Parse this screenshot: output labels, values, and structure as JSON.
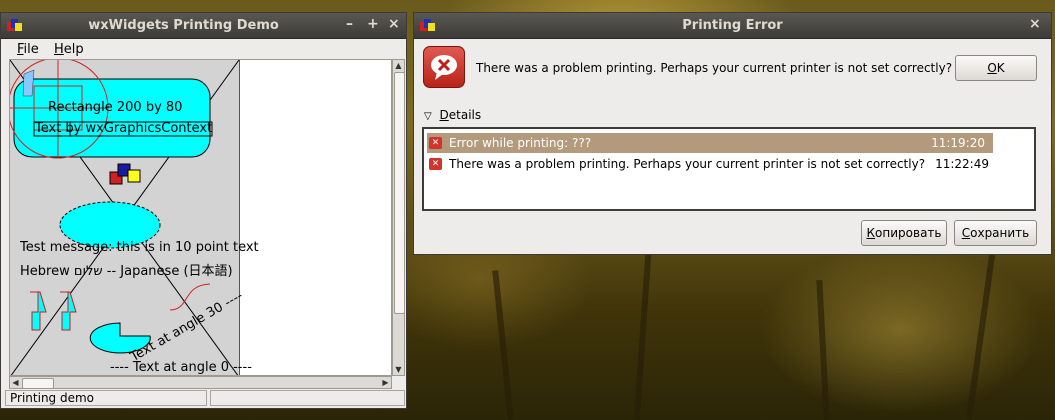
{
  "left_window": {
    "title": "wxWidgets Printing Demo",
    "controls": {
      "minimize": "–",
      "maximize": "+",
      "close": "×"
    },
    "menu": [
      {
        "label": "File",
        "accel": "F",
        "rest": "ile"
      },
      {
        "label": "Help",
        "accel": "H",
        "rest": "elp"
      }
    ],
    "canvas": {
      "rect_text": "Rectangle 200 by 80",
      "gc_text": "Text by wxGraphicsContext",
      "test_message": "Test message: this is in 10 point text",
      "hebrew_line": "Hebrew    שלום -- Japanese (日本語)",
      "angle30": "Text at angle 30 ----",
      "angle0": "---- Text at angle 0 ----"
    },
    "status": "Printing demo"
  },
  "dialog": {
    "title": "Printing Error",
    "close": "×",
    "message": "There was a problem printing. Perhaps your current printer is not set correctly?",
    "ok": {
      "accel": "O",
      "rest": "K"
    },
    "details": {
      "accel": "D",
      "rest": "etails"
    },
    "log": [
      {
        "text": "Error while printing: ???",
        "time": "11:19:20",
        "selected": true
      },
      {
        "text": "There was a problem printing. Perhaps your current printer is not set correctly?",
        "time": "11:22:49",
        "selected": false
      }
    ],
    "copy": {
      "accel": "К",
      "rest": "опировать"
    },
    "save": {
      "accel": "С",
      "rest": "охранить"
    }
  },
  "colors": {
    "accent": "#b39a7c",
    "error_red": "#d2332a",
    "cyan": "#00ffff",
    "titlebar": "#3c3b37"
  }
}
